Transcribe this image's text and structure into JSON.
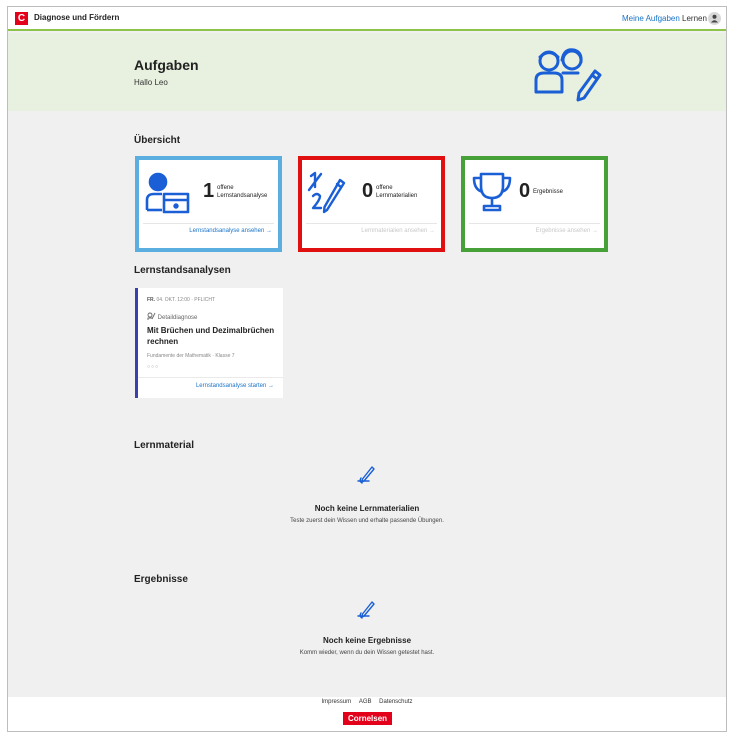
{
  "app": {
    "logo_letter": "C",
    "name": "Diagnose und Fördern"
  },
  "nav": {
    "tasks": "Meine Aufgaben",
    "learn": "Lernen"
  },
  "hero": {
    "title": "Aufgaben",
    "greeting": "Hallo Leo"
  },
  "overview": {
    "title": "Übersicht",
    "cards": [
      {
        "count": "1",
        "label_line1": "offene",
        "label_line2": "Lernstandsanalyse",
        "link": "Lernstandsanalyse ansehen",
        "link_enabled": true,
        "highlight_color": "#5aafe0"
      },
      {
        "count": "0",
        "label_line1": "offene",
        "label_line2": "Lernmaterialien",
        "link": "Lernmaterialien ansehen",
        "link_enabled": false,
        "highlight_color": "#e01010"
      },
      {
        "count": "0",
        "label_line1": "Ergebnisse",
        "label_line2": "",
        "link": "Ergebnisse ansehen",
        "link_enabled": false,
        "highlight_color": "#48a038"
      }
    ]
  },
  "analyses": {
    "title": "Lernstandsanalysen",
    "item": {
      "weekday": "FR.",
      "date": "04. OKT. 12:00 · PFLICHT",
      "type": "Detaildiagnose",
      "title": "Mit Brüchen und Dezimalbrüchen rechnen",
      "subject": "Fundamente der Mathematik · Klasse 7",
      "progress_dots": "○○○",
      "action": "Lernstandsanalyse starten"
    }
  },
  "material": {
    "title": "Lernmaterial",
    "empty_title": "Noch keine Lernmaterialien",
    "empty_text": "Teste zuerst dein Wissen und erhalte passende Übungen."
  },
  "results": {
    "title": "Ergebnisse",
    "empty_title": "Noch keine Ergebnisse",
    "empty_text": "Komm wieder, wenn du dein Wissen getestet hast."
  },
  "footer": {
    "links": [
      "Impressum",
      "AGB",
      "Datenschutz"
    ],
    "brand": "Cornelsen"
  },
  "colors": {
    "accent": "#1a73c8",
    "brand_red": "#e3001b",
    "hero_bg": "#e8f1df",
    "topbar_border": "#8cc44a"
  }
}
